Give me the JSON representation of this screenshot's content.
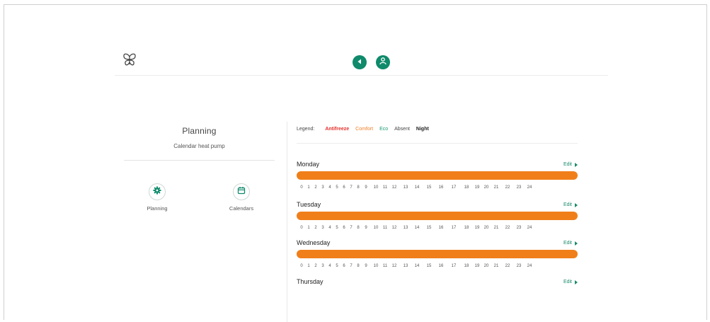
{
  "header": {
    "logo_icon": "butterfly-icon",
    "back_icon": "chevron-left-icon",
    "user_icon": "user-icon",
    "accent_color": "#0f8a6b"
  },
  "left_panel": {
    "title": "Planning",
    "subtitle": "Calendar heat pump",
    "buttons": [
      {
        "label": "Planning",
        "icon": "gear-icon"
      },
      {
        "label": "Calendars",
        "icon": "calendar-icon"
      }
    ]
  },
  "legend": {
    "label": "Legend:",
    "items": [
      {
        "label": "Antifreeze",
        "color": "#e5322d"
      },
      {
        "label": "Comfort",
        "color": "#f0802a"
      },
      {
        "label": "Eco",
        "color": "#1a9a72"
      },
      {
        "label": "Absent",
        "color": "#444444"
      },
      {
        "label": "Night",
        "color": "#222222"
      }
    ]
  },
  "schedule": {
    "edit_label": "Edit",
    "hour_labels": [
      "0",
      "1",
      "2",
      "3",
      "4",
      "5",
      "6",
      "7",
      "8",
      "9",
      "10",
      "11",
      "12",
      "13",
      "14",
      "15",
      "16",
      "17",
      "18",
      "19",
      "20",
      "21",
      "22",
      "23",
      "24"
    ],
    "days": [
      {
        "name": "Monday",
        "mode": "Comfort",
        "color": "#f07f1a"
      },
      {
        "name": "Tuesday",
        "mode": "Comfort",
        "color": "#f07f1a"
      },
      {
        "name": "Wednesday",
        "mode": "Comfort",
        "color": "#f07f1a"
      },
      {
        "name": "Thursday"
      }
    ]
  }
}
